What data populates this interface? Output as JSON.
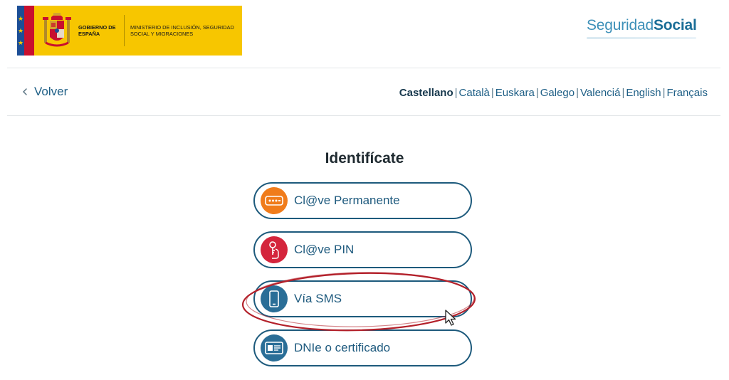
{
  "header": {
    "gov_line1": "GOBIERNO DE ESPAÑA",
    "gov_line2": "MINISTERIO DE INCLUSIÓN, SEGURIDAD SOCIAL Y MIGRACIONES",
    "brand_light": "Seguridad",
    "brand_bold": "Social"
  },
  "nav": {
    "back_label": "Volver",
    "languages": [
      "Castellano",
      "Català",
      "Euskara",
      "Galego",
      "Valenciá",
      "English",
      "Français"
    ],
    "active_language": "Castellano",
    "separator": "|"
  },
  "main": {
    "title": "Identifícate",
    "options": [
      {
        "label": "Cl@ve Permanente",
        "icon": "password-field-icon",
        "color": "#f07c1b"
      },
      {
        "label": "Cl@ve PIN",
        "icon": "key-hand-icon",
        "color": "#d4253c"
      },
      {
        "label": "Vía SMS",
        "icon": "mobile-phone-icon",
        "color": "#2a6e97"
      },
      {
        "label": "DNIe o certificado",
        "icon": "id-card-icon",
        "color": "#2a6e97"
      }
    ]
  },
  "annotation": {
    "highlight_color": "#b3202a",
    "highlighted_option": "Vía SMS"
  }
}
